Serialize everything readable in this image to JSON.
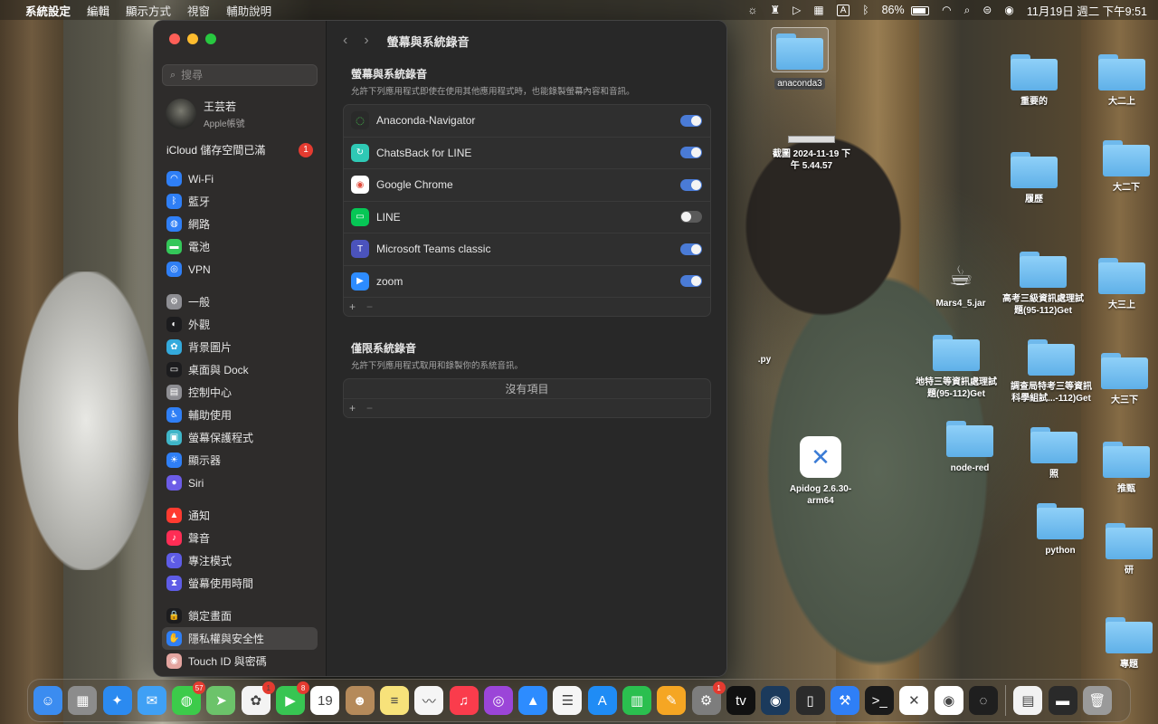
{
  "menubar": {
    "app_name": "系統設定",
    "menus": [
      "編輯",
      "顯示方式",
      "視窗",
      "輔助說明"
    ],
    "battery": "86%",
    "datetime": "11月19日 週二 下午9:51",
    "input_label": "A"
  },
  "window": {
    "search_placeholder": "搜尋",
    "account": {
      "name": "王芸若",
      "subtitle": "Apple帳號"
    },
    "icloud": {
      "label": "iCloud 儲存空間已滿",
      "badge": "1"
    },
    "sidebar_groups": [
      [
        {
          "label": "Wi-Fi",
          "icon": "wifi-icon",
          "color": "#2f7ff6",
          "glyph": "◠"
        },
        {
          "label": "藍牙",
          "icon": "bluetooth-icon",
          "color": "#2f7ff6",
          "glyph": "ᛒ"
        },
        {
          "label": "網路",
          "icon": "network-icon",
          "color": "#2f7ff6",
          "glyph": "◍"
        },
        {
          "label": "電池",
          "icon": "battery-icon",
          "color": "#34c759",
          "glyph": "▬"
        },
        {
          "label": "VPN",
          "icon": "vpn-icon",
          "color": "#2f7ff6",
          "glyph": "◎"
        }
      ],
      [
        {
          "label": "一般",
          "icon": "gear-icon",
          "color": "#8e8e93",
          "glyph": "⚙"
        },
        {
          "label": "外觀",
          "icon": "appearance-icon",
          "color": "#1c1c1e",
          "glyph": "◐"
        },
        {
          "label": "背景圖片",
          "icon": "wallpaper-icon",
          "color": "#34aadc",
          "glyph": "✿"
        },
        {
          "label": "桌面與 Dock",
          "icon": "dock-icon",
          "color": "#1c1c1e",
          "glyph": "▭"
        },
        {
          "label": "控制中心",
          "icon": "control-center-icon",
          "color": "#8e8e93",
          "glyph": "▤"
        },
        {
          "label": "輔助使用",
          "icon": "accessibility-icon",
          "color": "#2f7ff6",
          "glyph": "♿"
        },
        {
          "label": "螢幕保護程式",
          "icon": "screensaver-icon",
          "color": "#3fb6c9",
          "glyph": "▣"
        },
        {
          "label": "顯示器",
          "icon": "display-icon",
          "color": "#2f7ff6",
          "glyph": "☀"
        },
        {
          "label": "Siri",
          "icon": "siri-icon",
          "color": "#6c5ce7",
          "glyph": "●"
        }
      ],
      [
        {
          "label": "通知",
          "icon": "notification-icon",
          "color": "#ff3b30",
          "glyph": "▲"
        },
        {
          "label": "聲音",
          "icon": "sound-icon",
          "color": "#ff2d55",
          "glyph": "♪"
        },
        {
          "label": "專注模式",
          "icon": "focus-icon",
          "color": "#5e5ce6",
          "glyph": "☾"
        },
        {
          "label": "螢幕使用時間",
          "icon": "screentime-icon",
          "color": "#5e5ce6",
          "glyph": "⧗"
        }
      ],
      [
        {
          "label": "鎖定畫面",
          "icon": "lock-icon",
          "color": "#1c1c1e",
          "glyph": "🔒"
        },
        {
          "label": "隱私權與安全性",
          "icon": "privacy-hand-icon",
          "color": "#2f7ff6",
          "glyph": "✋",
          "selected": true
        },
        {
          "label": "Touch ID 與密碼",
          "icon": "fingerprint-icon",
          "color": "#e4a5a0",
          "glyph": "◉"
        }
      ]
    ],
    "toolbar_title": "螢幕與系統錄音",
    "section1": {
      "title": "螢幕與系統錄音",
      "desc": "允許下列應用程式即使在使用其他應用程式時，也能錄製螢幕內容和音訊。",
      "apps": [
        {
          "name": "Anaconda-Navigator",
          "icon": "anaconda-icon",
          "color": "#2a2a2a",
          "glyph": "◌",
          "enabled": true
        },
        {
          "name": "ChatsBack for LINE",
          "icon": "chatsback-icon",
          "color": "#2fc9b5",
          "glyph": "↻",
          "enabled": true
        },
        {
          "name": "Google Chrome",
          "icon": "chrome-icon",
          "color": "#ffffff",
          "glyph": "◉",
          "enabled": true
        },
        {
          "name": "LINE",
          "icon": "line-icon",
          "color": "#06c755",
          "glyph": "▭",
          "enabled": false
        },
        {
          "name": "Microsoft Teams classic",
          "icon": "teams-icon",
          "color": "#4b53bc",
          "glyph": "T",
          "enabled": true
        },
        {
          "name": "zoom",
          "icon": "zoom-icon",
          "color": "#2d8cff",
          "glyph": "▶",
          "enabled": true
        }
      ],
      "add": "+",
      "remove": "−"
    },
    "section2": {
      "title": "僅限系統錄音",
      "desc": "允許下列應用程式取用和錄製你的系統音訊。",
      "empty": "沒有項目",
      "add": "+",
      "remove": "−"
    }
  },
  "desktop": {
    "items": [
      {
        "label": "anaconda3",
        "type": "folder",
        "selected": true
      },
      {
        "label": "截圖 2024-11-19 下午 5.44.57",
        "type": "screenshot"
      },
      {
        "label": "重要的",
        "type": "folder"
      },
      {
        "label": "大二上",
        "type": "folder"
      },
      {
        "label": "履歷",
        "type": "folder"
      },
      {
        "label": "大二下",
        "type": "folder"
      },
      {
        "label": "Mars4_5.jar",
        "type": "jar"
      },
      {
        "label": "高考三級資訊處理試題(95-112)Get",
        "type": "folder"
      },
      {
        "label": "大三上",
        "type": "folder"
      },
      {
        "label": ".py",
        "type": "partial"
      },
      {
        "label": "地特三等資訊處理試題(95-112)Get",
        "type": "folder"
      },
      {
        "label": "調查局特考三等資訊科學組試...-112)Get",
        "type": "folder"
      },
      {
        "label": "大三下",
        "type": "folder"
      },
      {
        "label": "Apidog 2.6.30-arm64",
        "type": "app"
      },
      {
        "label": "node-red",
        "type": "folder"
      },
      {
        "label": "照",
        "type": "folder"
      },
      {
        "label": "推甄",
        "type": "folder"
      },
      {
        "label": "python",
        "type": "folder"
      },
      {
        "label": "研",
        "type": "folder"
      },
      {
        "label": "專題",
        "type": "folder"
      }
    ]
  },
  "dock": {
    "apps": [
      {
        "name": "finder-icon",
        "color": "#3b8cf0",
        "glyph": "☺"
      },
      {
        "name": "launchpad-icon",
        "color": "#8c8c8c",
        "glyph": "▦"
      },
      {
        "name": "safari-icon",
        "color": "#2b8af0",
        "glyph": "✦"
      },
      {
        "name": "mail-icon",
        "color": "#3fa0f5",
        "glyph": "✉"
      },
      {
        "name": "messages-icon",
        "color": "#3ccb4a",
        "glyph": "◍",
        "badge": "57"
      },
      {
        "name": "maps-icon",
        "color": "#6cc36a",
        "glyph": "➤"
      },
      {
        "name": "photos-icon",
        "color": "#f3f3f3",
        "glyph": "✿",
        "badge": "1"
      },
      {
        "name": "facetime-icon",
        "color": "#38c552",
        "glyph": "▶",
        "badge": "8"
      },
      {
        "name": "calendar-icon",
        "color": "#ffffff",
        "glyph": "19"
      },
      {
        "name": "contacts-icon",
        "color": "#b58a5a",
        "glyph": "☻"
      },
      {
        "name": "notes-icon",
        "color": "#f7e27a",
        "glyph": "≡"
      },
      {
        "name": "freeform-icon",
        "color": "#f5f5f5",
        "glyph": "〰"
      },
      {
        "name": "music-icon",
        "color": "#fa3c4c",
        "glyph": "♫"
      },
      {
        "name": "podcasts-icon",
        "color": "#9b45d8",
        "glyph": "◎"
      },
      {
        "name": "keynote-icon",
        "color": "#2d8cff",
        "glyph": "▲"
      },
      {
        "name": "reminders-icon",
        "color": "#f5f5f5",
        "glyph": "☰"
      },
      {
        "name": "appstore-icon",
        "color": "#1f8cf5",
        "glyph": "A"
      },
      {
        "name": "numbers-icon",
        "color": "#2bbf4f",
        "glyph": "▥"
      },
      {
        "name": "pages-icon",
        "color": "#f5a623",
        "glyph": "✎"
      },
      {
        "name": "system-settings-icon",
        "color": "#7d7d7d",
        "glyph": "⚙",
        "badge": "1"
      },
      {
        "name": "appletv-icon",
        "color": "#111111",
        "glyph": "tv"
      },
      {
        "name": "steam-icon",
        "color": "#1b3a5c",
        "glyph": "◉"
      },
      {
        "name": "iphone-mirroring-icon",
        "color": "#2b2b2b",
        "glyph": "▯"
      },
      {
        "name": "xcode-icon",
        "color": "#2f7ff6",
        "glyph": "⚒"
      },
      {
        "name": "terminal-icon",
        "color": "#1a1a1a",
        "glyph": ">_"
      },
      {
        "name": "apidog-icon",
        "color": "#ffffff",
        "glyph": "✕"
      },
      {
        "name": "chrome-icon",
        "color": "#ffffff",
        "glyph": "◉"
      },
      {
        "name": "anaconda-icon",
        "color": "#1f1f1f",
        "glyph": "◌"
      }
    ],
    "extras": [
      {
        "name": "document-icon",
        "color": "#f2f2f2",
        "glyph": "▤"
      },
      {
        "name": "screenshot-stack-icon",
        "color": "#2a2a2a",
        "glyph": "▬"
      },
      {
        "name": "trash-icon",
        "color": "#9a9a9a",
        "glyph": "🗑"
      }
    ]
  }
}
